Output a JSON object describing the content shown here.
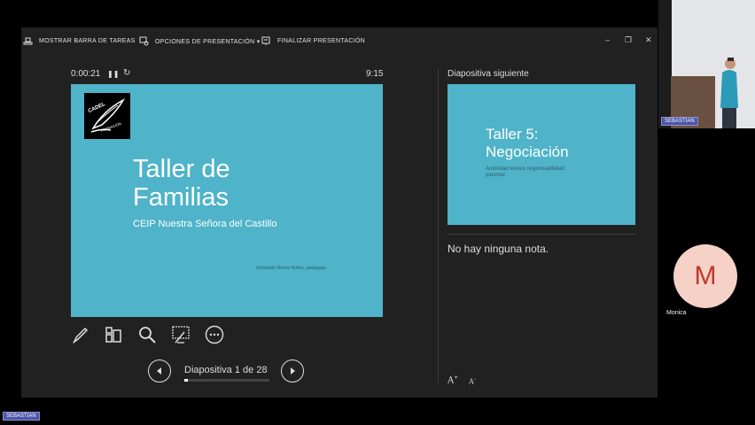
{
  "toolbar": {
    "taskbar_label": "MOSTRAR BARRA DE TAREAS",
    "options_label": "OPCIONES DE PRESENTACIÓN ▾",
    "end_label": "FINALIZAR PRESENTACIÓN",
    "minimize": "–",
    "restore": "❐",
    "close": "✕"
  },
  "timer": {
    "elapsed": "0:00:21",
    "pause_icon": "❚❚",
    "reset_icon": "↻",
    "clock": "9:15"
  },
  "current_slide": {
    "logo_line1": "CADEL",
    "logo_line2": "FORMACIÓN",
    "title_line1": "Taller de",
    "title_line2": "Familias",
    "subtitle": "CEIP Nuestra Señora del Castillo",
    "author": "Sebastián Rivera Núñez, pedagogo",
    "background": "#4fb3c9"
  },
  "tools": [
    "pen-icon",
    "slides-icon",
    "zoom-icon",
    "laser-icon",
    "more-icon"
  ],
  "navigation": {
    "counter": "Diapositiva 1 de 28",
    "progress": 0.04
  },
  "next_slide": {
    "label": "Diapositiva siguiente",
    "title_line1": "Taller 5:",
    "title_line2": "Negociación",
    "subtitle_line1": "Autoridad versus responsabilidad",
    "subtitle_line2": "parental"
  },
  "notes": {
    "text": "No hay ninguna nota."
  },
  "font_controls": {
    "increase": "A",
    "decrease": "A"
  },
  "participants": {
    "video_name": "SEBASTIAN",
    "monica_initial": "M",
    "monica_name": "Monica",
    "bottom_name": "SEBASTIAN",
    "avatar_bg": "#f6d1c8",
    "avatar_fg": "#c0392b"
  }
}
